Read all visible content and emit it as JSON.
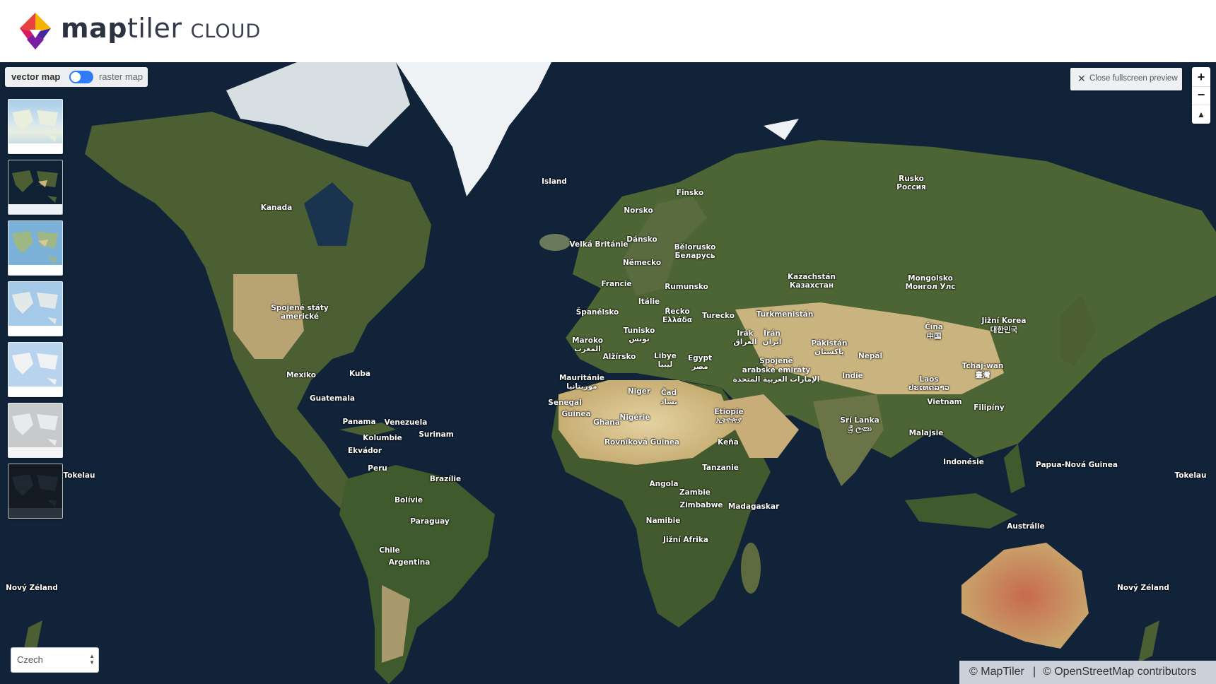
{
  "brand": {
    "name_part1": "map",
    "name_part2": "tiler",
    "name_part3": "CLOUD"
  },
  "toggle": {
    "left_label": "vector map",
    "right_label": "raster map",
    "state": "vector"
  },
  "close_preview": {
    "label": "Close fullscreen preview"
  },
  "zoom": {
    "in": "+",
    "out": "−",
    "compass": "▲"
  },
  "language": {
    "selected": "Czech"
  },
  "attribution": {
    "maptiler": "© MapTiler",
    "sep": "|",
    "osm": "© OpenStreetMap contributors"
  },
  "colors": {
    "ocean": "#102338",
    "land": "#4b5f33",
    "desert": "#c7b27c",
    "ice": "#eef2f4",
    "accent": "#2f7cf6"
  },
  "style_thumbnails": [
    "streets",
    "satellite-hybrid",
    "topo",
    "basic",
    "bright",
    "pastel",
    "dark"
  ],
  "labels": {
    "island": "Island",
    "finsko": "Finsko",
    "norsko": "Norsko",
    "rusko": "Rusko",
    "rossija": "Россия",
    "kanada": "Kanada",
    "velka_britanie": "Velká Británie",
    "dansko": "Dánsko",
    "belorusko": "Bělorusko",
    "belarus": "Беларусь",
    "nemecko": "Německo",
    "francie": "Francie",
    "rumunsko": "Rumunsko",
    "kazachstan": "Kazachstán",
    "kazachstan_cyr": "Казахстан",
    "mongolsko": "Mongolsko",
    "mongol_uls": "Монгол Улс",
    "italie": "Itálie",
    "recko": "Řecko",
    "ellada": "Ελλάδα",
    "turecko": "Turecko",
    "turkmenistan": "Turkmenistán",
    "spanelsko": "Španělsko",
    "spojene_staty": "Spojené státy",
    "americke": "americké",
    "tunisko": "Tunisko",
    "tunis_ar": "تونس",
    "maroko": "Maroko",
    "maroko_ar": "المغرب",
    "alzirsko": "Alžírsko",
    "libye": "Libye",
    "libye_ar": "ليبيا",
    "egypt": "Egypt",
    "egypt_ar": "مصر",
    "irak": "Irák",
    "irak_ar": "العراق",
    "iran": "Írán",
    "iran_ar": "ایران",
    "pakistan": "Pákistán",
    "pakistan_ar": "پاکستان",
    "nepal": "Nepál",
    "cina": "Čína",
    "cina_cjk": "中国",
    "jizni_korea": "Jižní Korea",
    "korea_cjk": "대한민국",
    "spojene_emiraty": "Spojené",
    "arabske_emiraty": "arabské emiráty",
    "emiraty_ar": "الإمارات العربية المتحدة",
    "mexiko": "Mexiko",
    "kuba": "Kuba",
    "mauritanie": "Mauritánie",
    "mauritanie_ar": "موريتانيا",
    "indie": "Indie",
    "tchaj_wan": "Tchaj-wan",
    "taiwan_cjk": "臺灣",
    "laos": "Laos",
    "laos_native": "ປະເທດລາວ",
    "guatemala": "Guatemala",
    "senegal": "Senegal",
    "niger": "Niger",
    "cad": "Čad",
    "cad_ar": "تشاد",
    "etiopie": "Etiopie",
    "etiopie_native": "ኢትዮጵያ",
    "vietnam": "Vietnam",
    "filipiny": "Filipíny",
    "guinea": "Guinea",
    "ghana": "Ghana",
    "nigerie": "Nigérie",
    "sri_lanka": "Srí Lanka",
    "sri_lanka_native": "ශ්‍රී ලංකා",
    "panama": "Panama",
    "venezuela": "Venezuela",
    "surinam": "Surinam",
    "kolumbie": "Kolumbie",
    "malajsie": "Malajsie",
    "rovnikova_guinea": "Rovníková Guinea",
    "kena": "Keňa",
    "ekvador": "Ekvádor",
    "indonesie": "Indonésie",
    "papua": "Papua-Nová Guinea",
    "peru": "Peru",
    "tanzanie": "Tanzanie",
    "tokelau": "Tokelau",
    "brazilie": "Brazílie",
    "angola": "Angola",
    "zambie": "Zambie",
    "bolivie": "Bolívie",
    "zimbabwe": "Zimbabwe",
    "madagaskar": "Madagaskar",
    "paraguay": "Paraguay",
    "namibie": "Namibie",
    "australie": "Austrálie",
    "jizni_afrika": "Jižní Afrika",
    "chile": "Chile",
    "argentina": "Argentina",
    "novy_zeland": "Nový Zéland"
  }
}
